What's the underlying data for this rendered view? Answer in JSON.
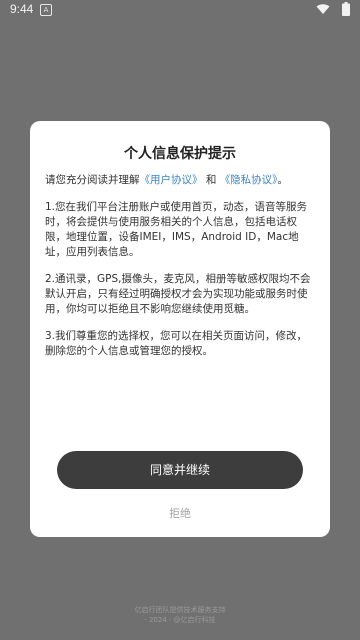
{
  "status_bar": {
    "time": "9:44",
    "notification_glyph": "A"
  },
  "dialog": {
    "title": "个人信息保护提示",
    "intro_prefix": "请您充分阅读并理解",
    "user_agreement_link": "《用户协议》",
    "intro_and": " 和 ",
    "privacy_link": "《隐私协议》",
    "intro_suffix": "。",
    "paragraphs": [
      "1.您在我们平台注册账户或使用首页，动态，语音等服务时，将会提供与使用服务相关的个人信息，包括电话权限，地理位置，设备IMEI，IMS，Android ID，Mac地址，应用列表信息。",
      "2.通讯录，GPS,摄像头，麦克风，相册等敏感权限均不会默认开启，只有经过明确授权才会为实现功能或服务时使用，你均可以拒绝且不影响您继续使用觅糖。",
      "3.我们尊重您的选择权，您可以在相关页面访问，修改，删除您的个人信息或管理您的授权。"
    ],
    "agree_label": "同意并继续",
    "reject_label": "拒绝"
  },
  "footer": {
    "line1": "亿启行团队提供技术服务支持",
    "line2": "· 2024 · @亿启行科技"
  },
  "icons": {
    "wifi": "wifi-icon",
    "battery": "battery-icon"
  },
  "colors": {
    "overlay": "#707070",
    "link": "#3d85c6",
    "button": "#3d3d3d"
  }
}
